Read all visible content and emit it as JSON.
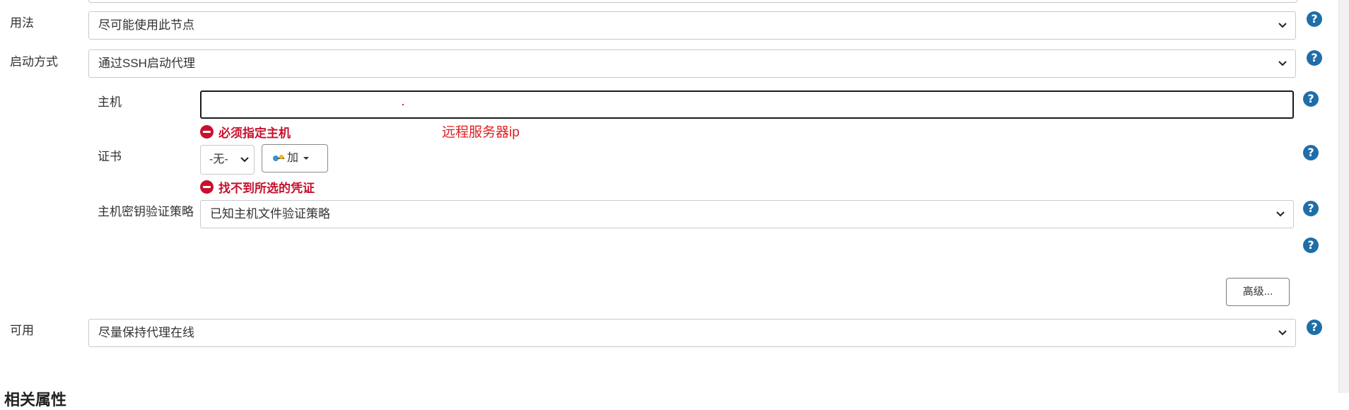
{
  "fields": {
    "usage": {
      "label": "用法",
      "value": "尽可能使用此节点"
    },
    "launch": {
      "label": "启动方式",
      "value": "通过SSH启动代理"
    },
    "host": {
      "label": "主机",
      "value": "",
      "error": "必须指定主机",
      "annotation": "远程服务器ip"
    },
    "credentials": {
      "label": "证书",
      "value": "-无-",
      "add_label": "加",
      "error": "找不到所选的凭证"
    },
    "host_key": {
      "label": "主机密钥验证策略",
      "value": "已知主机文件验证策略"
    },
    "advanced_label": "高级...",
    "availability": {
      "label": "可用",
      "value": "尽量保持代理在线"
    }
  },
  "section": {
    "title": "相关属性"
  },
  "help_glyph": "?",
  "colors": {
    "help": "#1f6ea8",
    "error": "#c8102e",
    "annotation": "#e02020"
  }
}
